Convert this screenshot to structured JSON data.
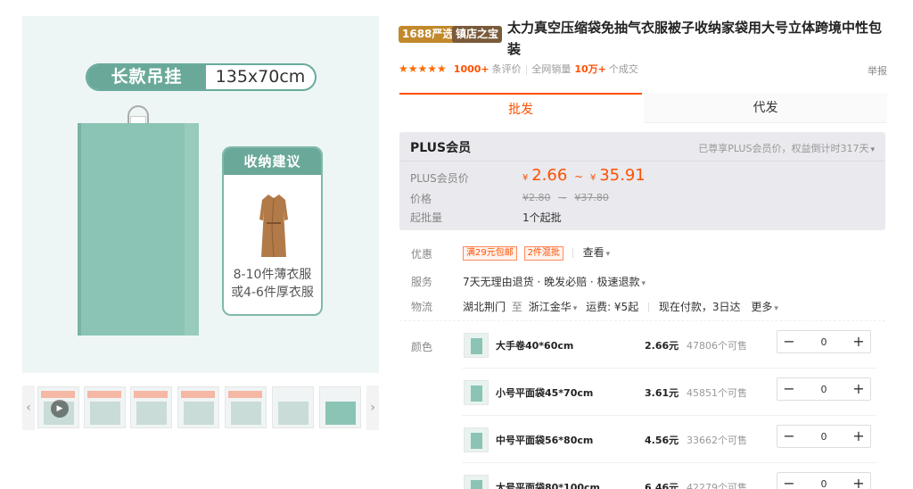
{
  "gallery": {
    "pill_left": "长款吊挂",
    "pill_right": "135x70cm",
    "tip_header": "收纳建议",
    "tip_line1": "8-10件薄衣服",
    "tip_line2": "或4-6件厚衣服",
    "thumb_count": 7,
    "left_arrow": "‹",
    "right_arrow": "›",
    "play_glyph": "▶"
  },
  "product": {
    "badge_1688": "1688严选",
    "badge_shop": "镇店之宝",
    "title": "太力真空压缩袋免抽气衣服被子收纳家袋用大号立体跨境中性包装",
    "stars": "★★★★★",
    "review_count": "1000+",
    "review_label": "条评价",
    "sales_label": "全网销量",
    "sales_count": "10万+",
    "sales_suffix": "个成交",
    "report": "举报"
  },
  "tabs": {
    "wholesale": "批发",
    "dropship": "代发"
  },
  "plus": {
    "title": "PLUS会员",
    "notice": "已尊享PLUS会员价，权益倒计时317天",
    "member_price_label": "PLUS会员价",
    "currency": "¥",
    "price_low": "2.66",
    "price_high": "35.91",
    "tilde": "~",
    "price_label": "价格",
    "orig_low": "¥2.80",
    "orig_sep": "~",
    "orig_high": "¥37.80",
    "moq_label": "起批量",
    "moq_value": "1个起批"
  },
  "offers": {
    "label": "优惠",
    "tag1": "满29元包邮",
    "tag2": "2件混批",
    "view": "查看"
  },
  "service": {
    "label": "服务",
    "value": "7天无理由退货 · 晚发必赔 · 极速退款"
  },
  "logistics": {
    "label": "物流",
    "from": "湖北荆门",
    "to_word": "至",
    "to": "浙江金华",
    "fee": "运费: ¥5起",
    "ship": "现在付款，3日达",
    "more": "更多"
  },
  "skus": {
    "label": "颜色",
    "items": [
      {
        "name": "大手卷40*60cm",
        "price": "2.66元",
        "stock": "47806个可售",
        "qty": "0"
      },
      {
        "name": "小号平面袋45*70cm",
        "price": "3.61元",
        "stock": "45851个可售",
        "qty": "0"
      },
      {
        "name": "中号平面袋56*80cm",
        "price": "4.56元",
        "stock": "33662个可售",
        "qty": "0"
      },
      {
        "name": "大号平面袋80*100cm",
        "price": "6.46元",
        "stock": "42279个可售",
        "qty": "0"
      }
    ],
    "minus": "−",
    "plus": "+"
  },
  "colors": {
    "accent": "#ff5000",
    "brand_green": "#6aa999",
    "badge_gold": "#c2892c",
    "badge_brown": "#7a5a3a"
  }
}
